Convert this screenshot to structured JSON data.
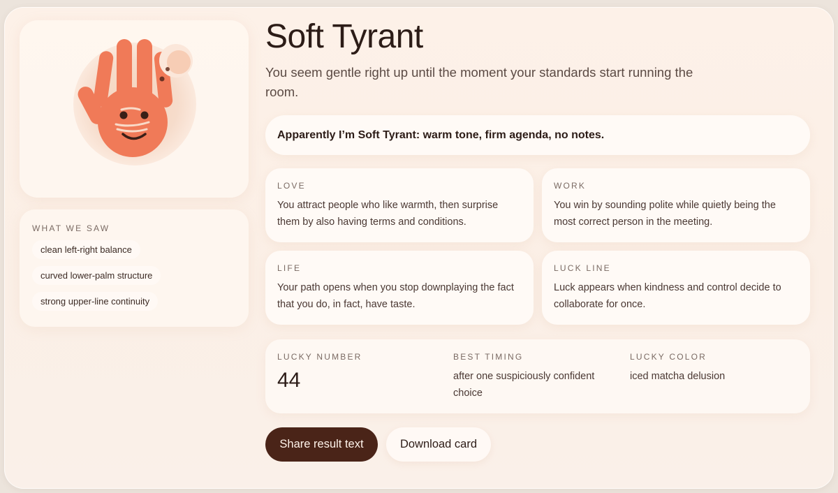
{
  "result": {
    "title": "Soft Tyrant",
    "subtitle": "You seem gentle right up until the moment your standards start running the room.",
    "share_quote": "Apparently I’m Soft Tyrant: warm tone, firm agenda, no notes."
  },
  "illustration": {
    "icon": "palm-face-icon",
    "accent_color": "#f07a58"
  },
  "what_we_saw": {
    "label": "WHAT WE SAW",
    "items": [
      "clean left-right balance",
      "curved lower-palm structure",
      "strong upper-line continuity"
    ]
  },
  "readings": [
    {
      "label": "LOVE",
      "text": "You attract people who like warmth, then surprise them by also having terms and conditions."
    },
    {
      "label": "WORK",
      "text": "You win by sounding polite while quietly being the most correct person in the meeting."
    },
    {
      "label": "LIFE",
      "text": "Your path opens when you stop downplaying the fact that you do, in fact, have taste."
    },
    {
      "label": "LUCK LINE",
      "text": "Luck appears when kindness and control decide to collaborate for once."
    }
  ],
  "fortune": {
    "lucky_number_label": "LUCKY NUMBER",
    "lucky_number": "44",
    "best_timing_label": "BEST TIMING",
    "best_timing": "after one suspiciously confident choice",
    "lucky_color_label": "LUCKY COLOR",
    "lucky_color": "iced matcha delusion"
  },
  "actions": {
    "share_label": "Share result text",
    "download_label": "Download card"
  },
  "colors": {
    "primary_button": "#4a2418",
    "hand": "#f07a58",
    "background": "#fdf1e8"
  }
}
